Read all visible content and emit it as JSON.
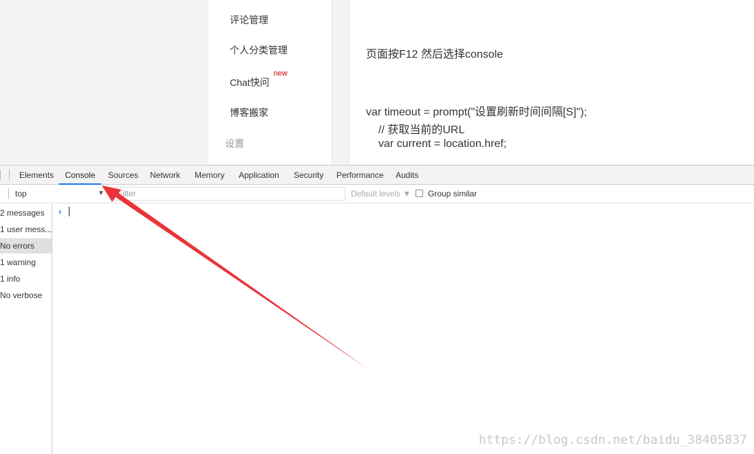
{
  "page": {
    "sidebar": {
      "items": [
        {
          "label": "评论管理"
        },
        {
          "label": "个人分类管理"
        },
        {
          "label": "Chat快问",
          "badge": "new"
        },
        {
          "label": "博客搬家"
        },
        {
          "label": "设置"
        }
      ]
    },
    "content": {
      "lines": [
        "页面按F12 然后选择console",
        "var timeout = prompt(\"设置刷新时间间隔[S]\");",
        "// 获取当前的URL",
        "var current = location.href;"
      ]
    }
  },
  "devtools": {
    "tabs": [
      "Elements",
      "Console",
      "Sources",
      "Network",
      "Memory",
      "Application",
      "Security",
      "Performance",
      "Audits"
    ],
    "active_tab": "Console",
    "filterbar": {
      "context": "top",
      "filter_placeholder": "Filter",
      "default_levels": "Default levels",
      "group_similar": "Group similar"
    },
    "sidebar": {
      "items": [
        "2 messages",
        "1 user mess...",
        "No errors",
        "1 warning",
        "1 info",
        "No verbose"
      ],
      "selected": "No errors"
    },
    "console": {
      "prompt": "›"
    }
  },
  "watermark": "https://blog.csdn.net/baidu_38405837",
  "colors": {
    "accent": "#1a73e8",
    "arrow": "#e8343a",
    "badge": "#cc0000"
  },
  "icons": [
    "dropdown-triangle-icon",
    "prompt-chevron-icon",
    "annotation-arrow"
  ]
}
